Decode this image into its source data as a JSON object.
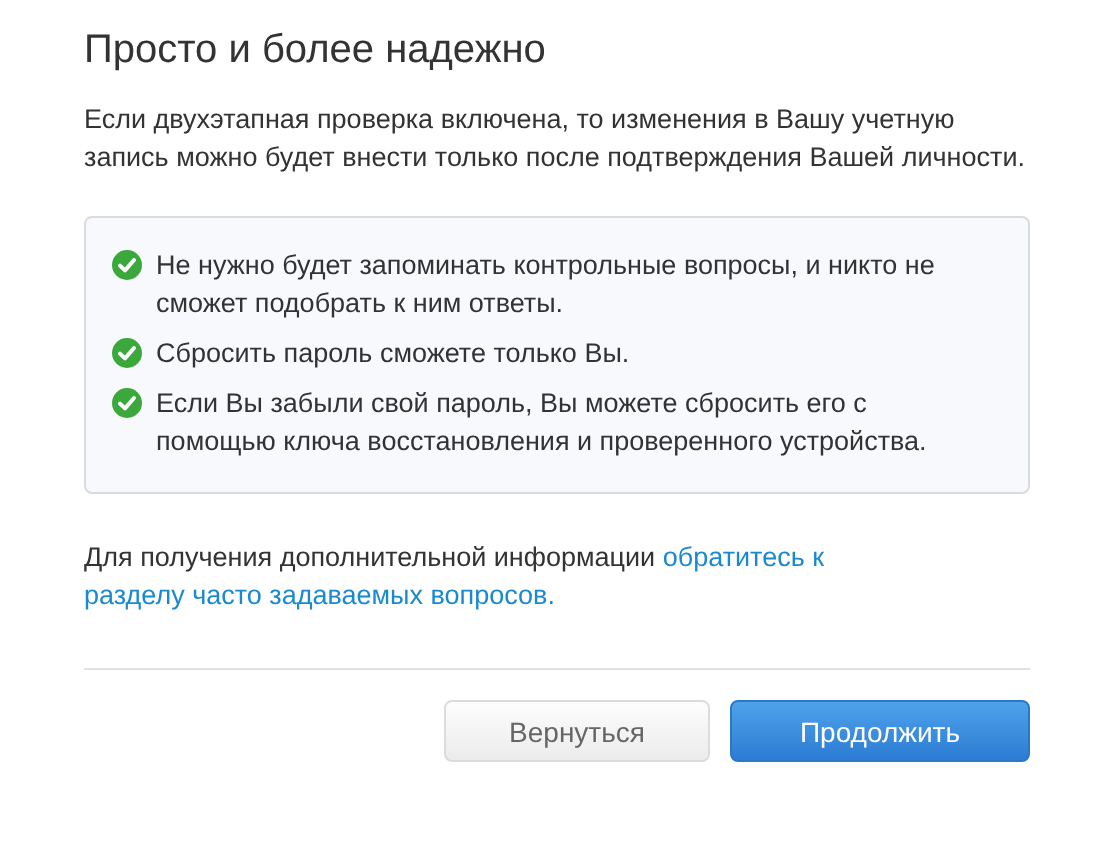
{
  "title": "Просто и более надежно",
  "intro": "Если двухэтапная проверка включена, то изменения в Вашу учетную запись можно будет внести только после подтверждения Вашей личности.",
  "benefits": [
    {
      "text": "Не нужно будет запоминать контрольные вопросы, и никто не сможет подобрать к ним ответы."
    },
    {
      "text": "Сбросить пароль сможете только Вы."
    },
    {
      "text": "Если Вы забыли свой пароль, Вы можете сбросить его с помощью ключа восстановления и проверенного устройства."
    }
  ],
  "info": {
    "text": "Для получения дополнительной информации",
    "link_lines": [
      "обратитесь к",
      "разделу часто задаваемых вопросов."
    ]
  },
  "buttons": [
    {
      "label": "Вернуться",
      "kind": "secondary"
    },
    {
      "label": "Продолжить",
      "kind": "primary"
    }
  ]
}
